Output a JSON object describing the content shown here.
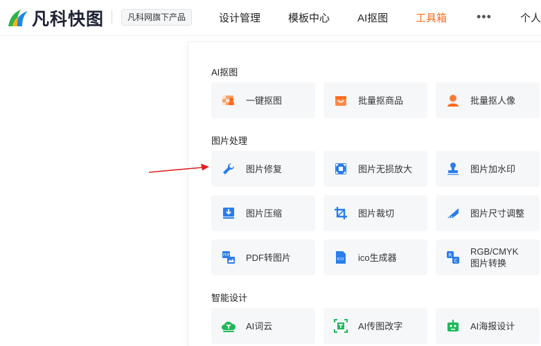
{
  "header": {
    "logo_text": "凡科快图",
    "sub_brand": "凡科网旗下产品",
    "nav": [
      {
        "label": "设计管理"
      },
      {
        "label": "模板中心"
      },
      {
        "label": "AI抠图"
      },
      {
        "label": "工具箱"
      },
      {
        "label": "个人"
      }
    ],
    "more_icon": "more-dots-icon",
    "active_nav": "工具箱",
    "accent_color": "#ff6a1a"
  },
  "menu": {
    "sections": [
      {
        "title": "AI抠图",
        "tools": [
          {
            "label": "一键抠图",
            "icon": "one-click-cutout-icon"
          },
          {
            "label": "批量抠商品",
            "icon": "batch-product-cutout-icon"
          },
          {
            "label": "批量抠人像",
            "icon": "batch-portrait-cutout-icon"
          }
        ]
      },
      {
        "title": "图片处理",
        "tools": [
          {
            "label": "图片修复",
            "icon": "wrench-icon"
          },
          {
            "label": "图片无损放大",
            "icon": "expand-icon"
          },
          {
            "label": "图片加水印",
            "icon": "stamp-icon"
          },
          {
            "label": "图片压缩",
            "icon": "compress-icon"
          },
          {
            "label": "图片裁切",
            "icon": "crop-icon"
          },
          {
            "label": "图片尺寸调整",
            "icon": "ruler-icon"
          },
          {
            "label": "PDF转图片",
            "icon": "pdf-to-image-icon"
          },
          {
            "label": "ico生成器",
            "icon": "ico-file-icon"
          },
          {
            "label": "RGB/CMYK",
            "label2": "图片转换",
            "icon": "rgb-cmyk-convert-icon"
          }
        ]
      },
      {
        "title": "智能设计",
        "tools": [
          {
            "label": "AI词云",
            "icon": "word-cloud-icon"
          },
          {
            "label": "AI传图改字",
            "icon": "image-text-edit-icon"
          },
          {
            "label": "AI海报设计",
            "icon": "robot-poster-icon"
          }
        ]
      }
    ]
  },
  "annotation": {
    "type": "red-arrow",
    "color": "#e02020"
  }
}
